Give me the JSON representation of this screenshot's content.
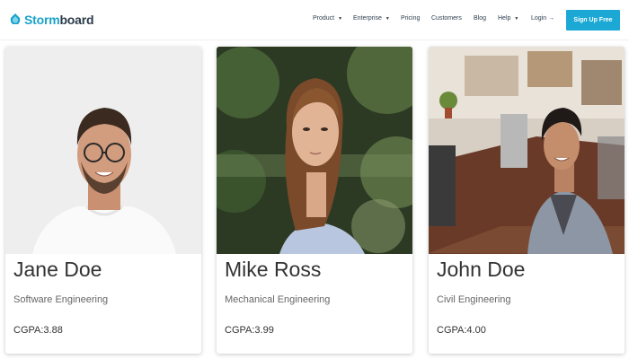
{
  "brand": {
    "name_prefix": "Storm",
    "name_suffix": "board"
  },
  "nav": {
    "items": [
      {
        "label": "Product",
        "has_caret": true
      },
      {
        "label": "Enterprise",
        "has_caret": true
      },
      {
        "label": "Pricing",
        "has_caret": false
      },
      {
        "label": "Customers",
        "has_caret": false
      },
      {
        "label": "Blog",
        "has_caret": false
      },
      {
        "label": "Help",
        "has_caret": true
      },
      {
        "label": "Login →",
        "has_caret": false
      }
    ],
    "signup_label": "Sign Up Free"
  },
  "colors": {
    "accent": "#1ba8d4",
    "brand_dark": "#2b3a4a"
  },
  "students": [
    {
      "name": "Jane Doe",
      "department": "Software Engineering",
      "cgpa": "CGPA:3.88"
    },
    {
      "name": "Mike Ross",
      "department": "Mechanical Engineering",
      "cgpa": "CGPA:3.99"
    },
    {
      "name": "John Doe",
      "department": "Civil Engineering",
      "cgpa": "CGPA:4.00"
    }
  ]
}
